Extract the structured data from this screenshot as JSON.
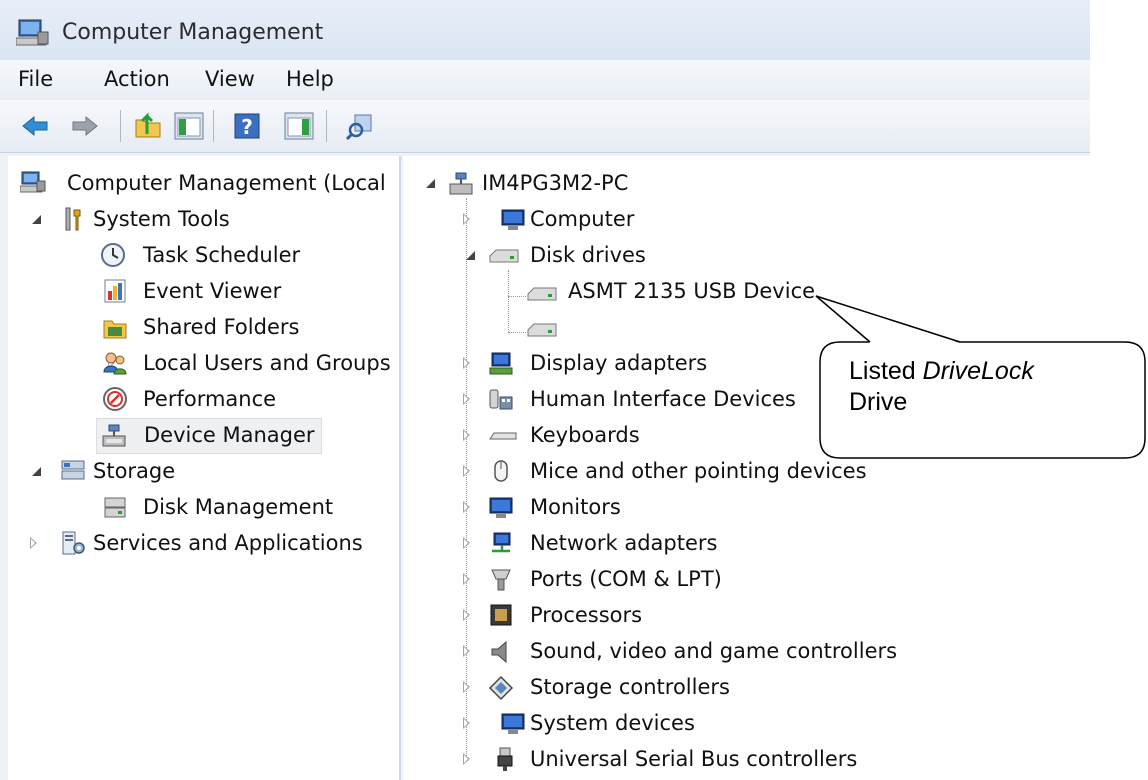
{
  "window": {
    "title": "Computer Management"
  },
  "menu": [
    "File",
    "Action",
    "View",
    "Help"
  ],
  "toolbar_icons": [
    "back-arrow-icon",
    "forward-arrow-icon",
    "up-folder-icon",
    "show-hide-console-tree-icon",
    "help-icon",
    "show-hide-action-pane-icon",
    "properties-icon"
  ],
  "left_tree": {
    "root": "Computer Management (Local",
    "system_tools": "System Tools",
    "task_scheduler": "Task Scheduler",
    "event_viewer": "Event Viewer",
    "shared_folders": "Shared Folders",
    "local_users": "Local Users and Groups",
    "performance": "Performance",
    "device_manager": "Device Manager",
    "storage": "Storage",
    "disk_management": "Disk Management",
    "services": "Services and Applications"
  },
  "device_tree": {
    "root": "IM4PG3M2-PC",
    "computer": "Computer",
    "disk_drives": "Disk drives",
    "asmt": "ASMT 2135 USB Device",
    "display_adapters": "Display adapters",
    "hid": "Human Interface Devices",
    "keyboards": "Keyboards",
    "mice": "Mice and other pointing devices",
    "monitors": "Monitors",
    "network": "Network adapters",
    "ports": "Ports (COM & LPT)",
    "processors": "Processors",
    "sound": "Sound, video and game controllers",
    "storage_ctrl": "Storage controllers",
    "system_devices": "System devices",
    "usb": "Universal Serial Bus controllers"
  },
  "callout": {
    "line1_prefix": "Listed ",
    "line1_italic": "DriveLock",
    "line2": "Drive"
  }
}
